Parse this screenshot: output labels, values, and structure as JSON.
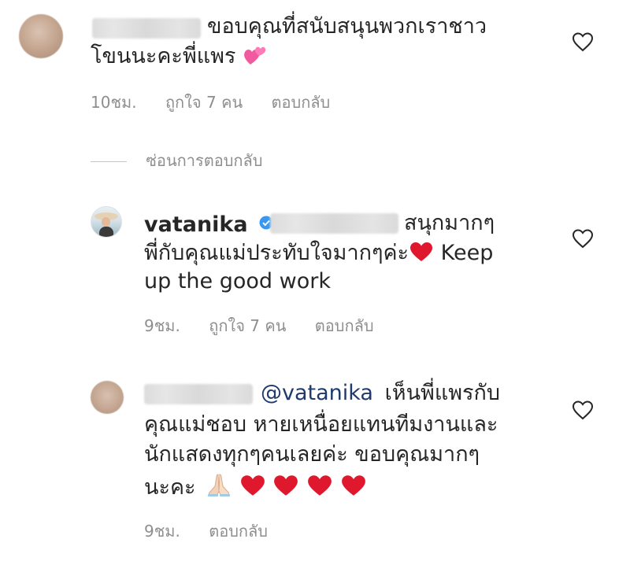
{
  "comments": [
    {
      "line1_text": "ขอบคุณที่สนับสนุนพวกเราชาว",
      "line2_text": "โขนนะคะพี่แพร",
      "line2_emoji": "two-hearts-emoji",
      "time": "10ชม.",
      "likes": "ถูกใจ 7 คน",
      "reply_label": "ตอบกลับ"
    },
    {
      "username": "vatanika",
      "line1_text": "สนุกมากๆ",
      "line2_text": "พี่กับคุณแม่ประทับใจมากๆค่ะ",
      "line2_tail": "Keep",
      "line3_text": "up the good work",
      "time": "9ชม.",
      "likes": "ถูกใจ 7 คน",
      "reply_label": "ตอบกลับ"
    },
    {
      "mention": "@vatanika",
      "line1_text": "เห็นพี่แพรกับ",
      "line2_text": "คุณแม่ชอบ หายเหนื่อยแทนทีมงานและ",
      "line3_text": "นักแสดงทุกๆคนเลยค่ะ ขอบคุณมากๆ",
      "line4_text": "นะคะ",
      "line4_emojis": [
        "folded-hands-emoji",
        "red-heart-emoji",
        "red-heart-emoji",
        "red-heart-emoji",
        "red-heart-emoji"
      ],
      "time": "9ชม.",
      "reply_label": "ตอบกลับ"
    }
  ],
  "hide_replies_label": "ซ่อนการตอบกลับ",
  "colors": {
    "text": "#262626",
    "meta": "#8e8e8e",
    "mention": "#1f3a6b",
    "verified": "#3897f0",
    "heart_red": "#e0182e"
  }
}
